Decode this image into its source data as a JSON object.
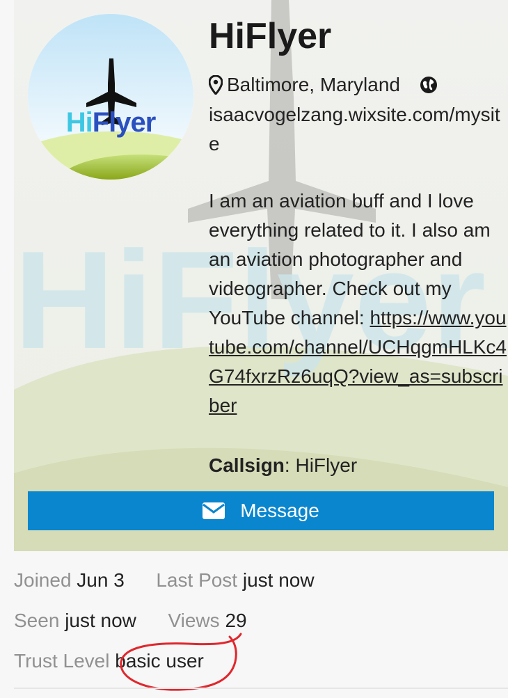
{
  "profile": {
    "username": "HiFlyer",
    "avatar_logo_text": "HiFlyer",
    "location": "Baltimore, Maryland",
    "website": "isaacvogelzang.wixsite.com/mysite",
    "bio_text": "I am an aviation buff and I love everything related to it. I also am an aviation photographer and videographer. Check out my YouTube channel:",
    "bio_link": "https://www.youtube.com/channel/UCHqgmHLKc4G74fxrzRz6uqQ?view_as=subscriber",
    "callsign_label": "Callsign",
    "callsign_sep": ":",
    "callsign_value": "HiFlyer",
    "background_watermark_text": "HiFlyer"
  },
  "actions": {
    "message_label": "Message"
  },
  "stats": {
    "joined_label": "Joined",
    "joined_value": "Jun 3",
    "last_post_label": "Last Post",
    "last_post_value": "just now",
    "seen_label": "Seen",
    "seen_value": "just now",
    "views_label": "Views",
    "views_value": "29",
    "trust_label": "Trust Level",
    "trust_value": "basic user"
  },
  "icons": {
    "location": "map-marker-icon",
    "website": "globe-icon",
    "message": "envelope-icon"
  },
  "colors": {
    "accent": "#0a86cf",
    "label_gray": "#919191",
    "annotation_red": "#e0272d",
    "logo_cyan": "#3ec7e3",
    "logo_blue": "#2a4fbf"
  }
}
